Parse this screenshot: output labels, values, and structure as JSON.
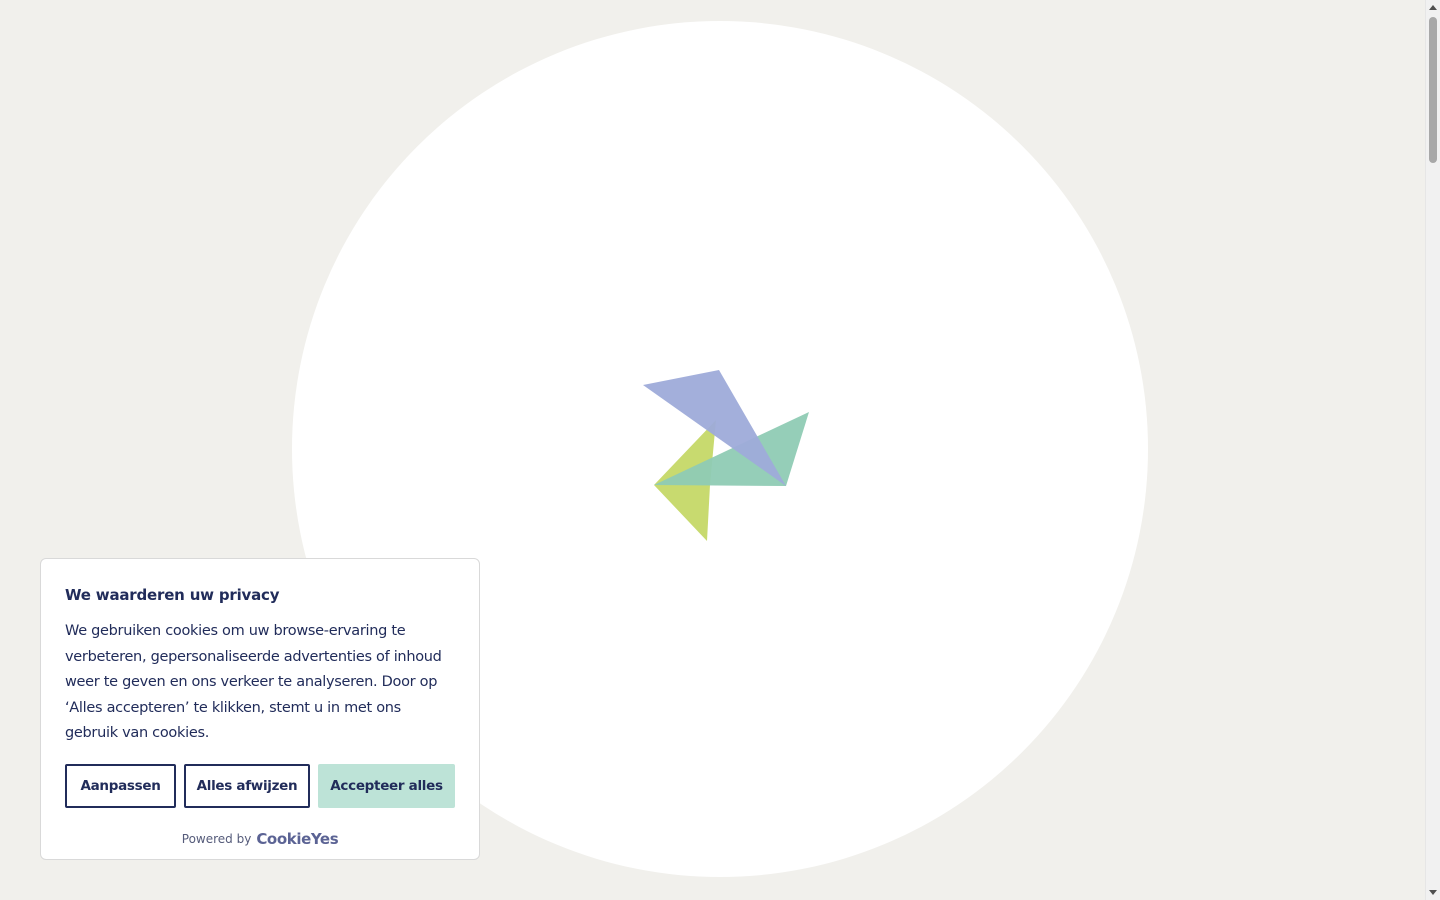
{
  "cookie_banner": {
    "title": "We waarderen uw privacy",
    "description": "We gebruiken cookies om uw browse-ervaring te verbeteren, gepersonaliseerde advertenties of inhoud weer te geven en ons verkeer te analyseren. Door op ‘Alles accepteren’ te klikken, stemt u in met ons gebruik van cookies.",
    "buttons": {
      "customize": "Aanpassen",
      "reject": "Alles afwijzen",
      "accept": "Accepteer alles"
    },
    "powered_by_label": "Powered by",
    "powered_by_brand": "CookieYes"
  },
  "colors": {
    "page_background": "#f1f0ec",
    "text": "#212c5a",
    "accept_button": "#bde3d7",
    "logo_blue": "#9eabd9",
    "logo_green": "#8fcbb4",
    "logo_yellow": "#c5d867"
  },
  "icons": {
    "loader": "pinwheel-logo-icon"
  }
}
